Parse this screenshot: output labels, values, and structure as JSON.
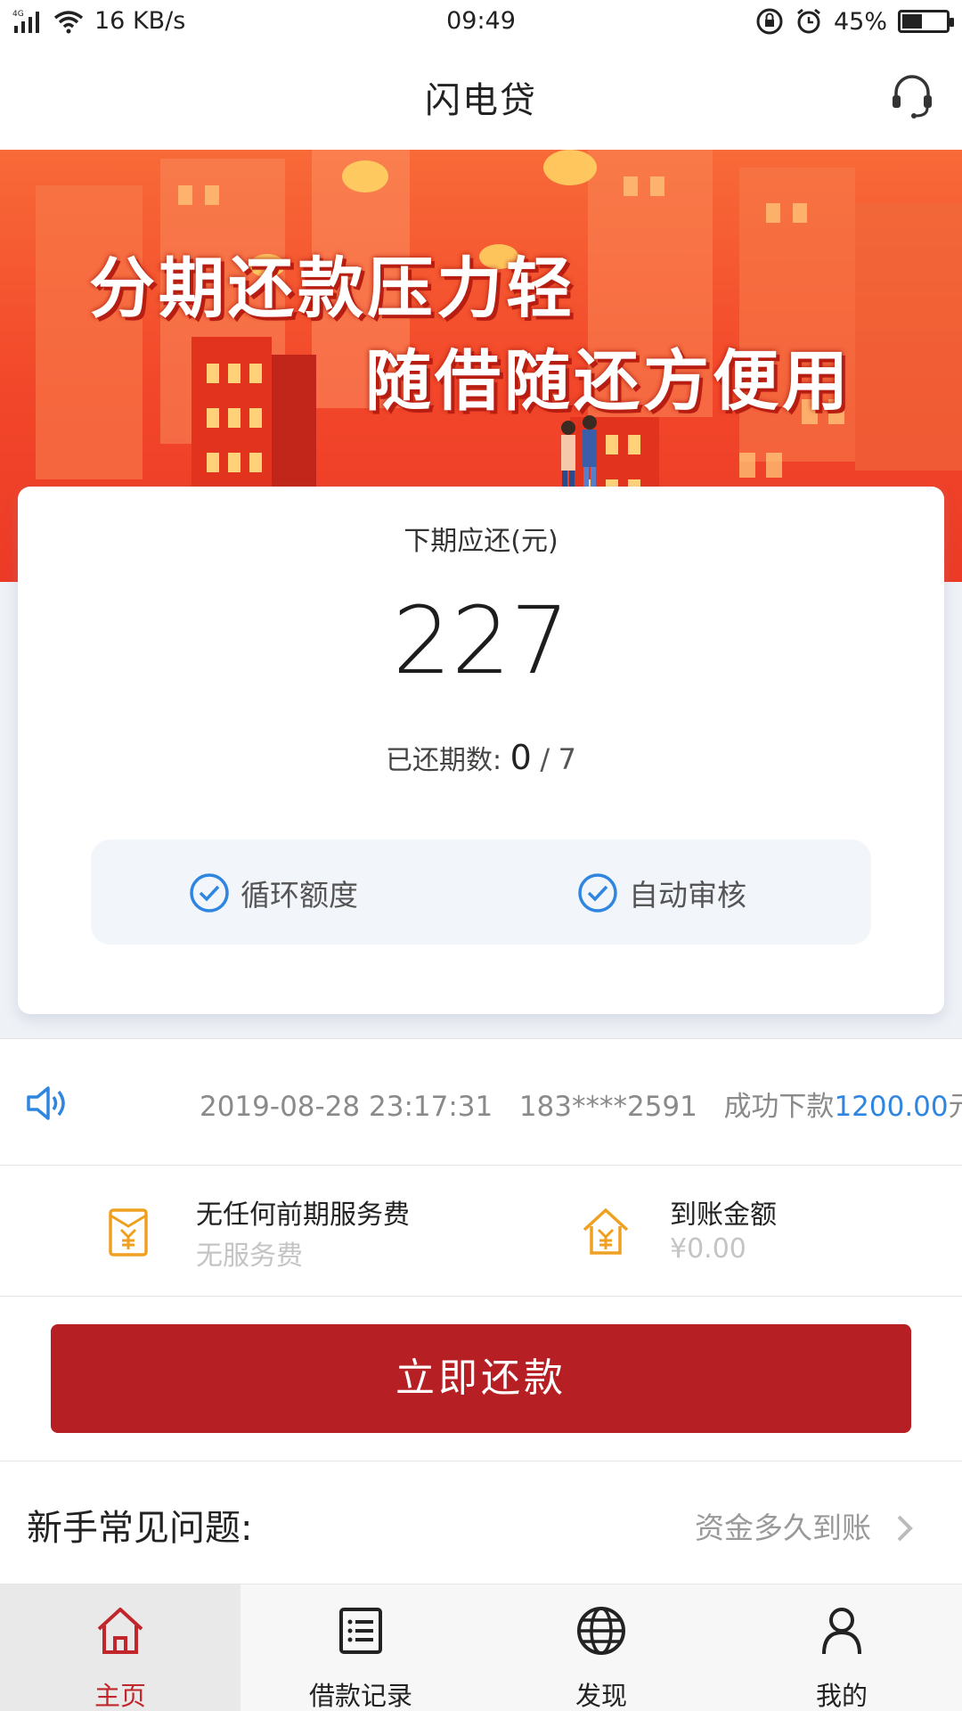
{
  "status_bar": {
    "network": "4G",
    "speed": "16 KB/s",
    "time": "09:49",
    "battery": "45%",
    "battery_level": 0.45
  },
  "header": {
    "title": "闪电贷"
  },
  "banner": {
    "line1": "分期还款压力轻",
    "line2": "随借随还方便用"
  },
  "repayment_card": {
    "label": "下期应还(元)",
    "amount": "227",
    "periods_label": "已还期数:",
    "periods_paid": "0",
    "periods_separator": "/",
    "periods_total": "7",
    "features": [
      "循环额度",
      "自动审核"
    ]
  },
  "ticker": {
    "datetime": "2019-08-28 23:17:31",
    "phone": "183****2591",
    "prefix": "成功下款",
    "amount": "1200.00",
    "suffix": "元"
  },
  "info": {
    "fee_title": "无任何前期服务费",
    "fee_sub": "无服务费",
    "arrival_title": "到账金额",
    "arrival_value": "¥0.00"
  },
  "action": {
    "repay_label": "立即还款"
  },
  "faq": {
    "title": "新手常见问题:",
    "link": "资金多久到账"
  },
  "tabs": [
    {
      "label": "主页",
      "icon": "home-icon",
      "active": true
    },
    {
      "label": "借款记录",
      "icon": "list-icon",
      "active": false
    },
    {
      "label": "发现",
      "icon": "globe-icon",
      "active": false
    },
    {
      "label": "我的",
      "icon": "user-icon",
      "active": false
    }
  ],
  "colors": {
    "accent": "#b62024",
    "link_blue": "#2f86e0",
    "icon_orange": "#f0a020",
    "check_blue": "#2f86e0"
  }
}
